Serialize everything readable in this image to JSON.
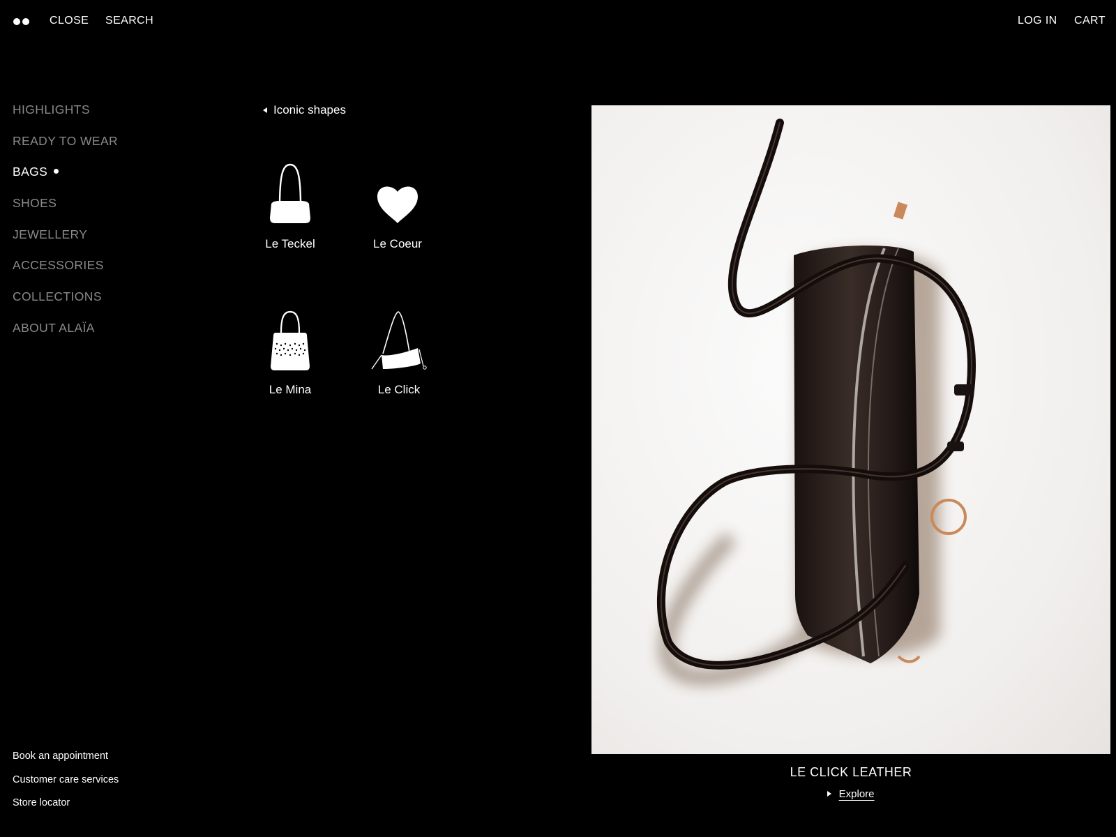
{
  "header": {
    "logo": "logo-mark",
    "close_label": "CLOSE",
    "search_label": "SEARCH",
    "login_label": "LOG IN",
    "cart_label": "CART"
  },
  "main_nav": {
    "items": [
      {
        "label": "HIGHLIGHTS",
        "active": false
      },
      {
        "label": "READY TO WEAR",
        "active": false
      },
      {
        "label": "BAGS",
        "active": true
      },
      {
        "label": "SHOES",
        "active": false
      },
      {
        "label": "JEWELLERY",
        "active": false
      },
      {
        "label": "ACCESSORIES",
        "active": false
      },
      {
        "label": "COLLECTIONS",
        "active": false
      },
      {
        "label": "ABOUT ALAÏA",
        "active": false
      }
    ]
  },
  "submenu": {
    "back_label": "Iconic shapes",
    "shapes": [
      {
        "label": "Le Teckel",
        "icon": "teckel-bag-icon"
      },
      {
        "label": "Le Coeur",
        "icon": "heart-bag-icon"
      },
      {
        "label": "Le Mina",
        "icon": "mina-bag-icon"
      },
      {
        "label": "Le Click",
        "icon": "click-bag-icon"
      }
    ]
  },
  "footer": {
    "links": [
      "Book an appointment",
      "Customer care services",
      "Store locator"
    ]
  },
  "feature": {
    "title": "LE CLICK LEATHER",
    "explore_label": "Explore",
    "image": "black-leather-click-bag-photo"
  },
  "colors": {
    "background": "#000000",
    "text": "#ffffff",
    "inactive_nav": "#8a8a8a",
    "photo_background": "#f3f1ef"
  }
}
